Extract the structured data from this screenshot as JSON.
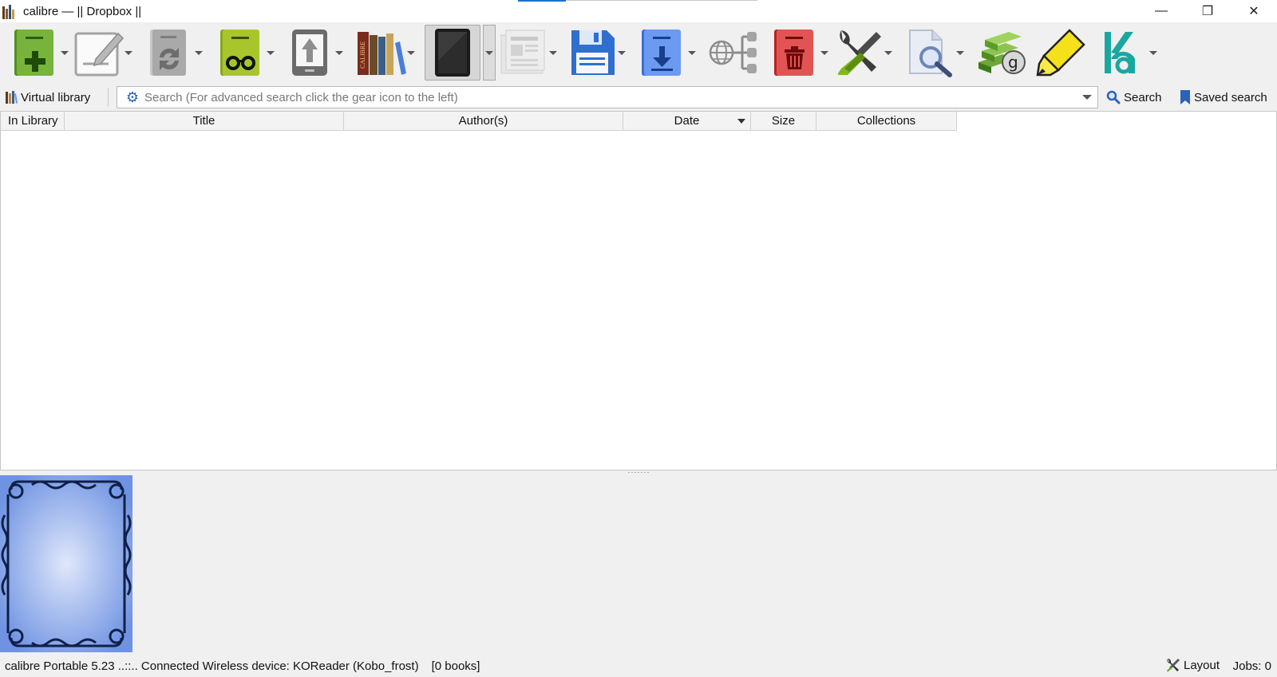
{
  "window": {
    "title": "calibre — || Dropbox ||",
    "controls": {
      "minimize": "—",
      "maximize": "❐",
      "close": "✕"
    }
  },
  "toolbar": {
    "items": [
      {
        "name": "add-books",
        "icon": "add-book-icon",
        "has_menu": true
      },
      {
        "name": "edit-metadata",
        "icon": "edit-metadata-icon",
        "has_menu": true
      },
      {
        "name": "convert-books",
        "icon": "convert-icon",
        "has_menu": true
      },
      {
        "name": "view",
        "icon": "view-book-icon",
        "has_menu": true
      },
      {
        "name": "send-to-device",
        "icon": "send-to-device-icon",
        "has_menu": true
      },
      {
        "name": "calibre-library",
        "icon": "library-icon",
        "has_menu": true
      },
      {
        "name": "device",
        "icon": "device-tablet-icon",
        "has_menu": true
      },
      {
        "name": "fetch-news",
        "icon": "news-icon",
        "has_menu": true
      },
      {
        "name": "save-to-disk",
        "icon": "save-icon",
        "has_menu": true
      },
      {
        "name": "get-books",
        "icon": "download-book-icon",
        "has_menu": true
      },
      {
        "name": "connect-share",
        "icon": "connect-share-icon",
        "has_menu": false
      },
      {
        "name": "remove-books",
        "icon": "trash-icon",
        "has_menu": true
      },
      {
        "name": "preferences",
        "icon": "tools-icon",
        "has_menu": true
      },
      {
        "name": "search-books",
        "icon": "document-search-icon",
        "has_menu": true
      },
      {
        "name": "goodreads",
        "icon": "goodreads-books-icon",
        "has_menu": false
      },
      {
        "name": "highlight",
        "icon": "highlighter-icon",
        "has_menu": false
      },
      {
        "name": "kobo-utilities",
        "icon": "kobo-icon",
        "has_menu": true
      }
    ]
  },
  "searchbar": {
    "virtual_library_label": "Virtual library",
    "placeholder": "Search (For advanced search click the gear icon to the left)",
    "value": "",
    "search_label": "Search",
    "saved_search_label": "Saved search"
  },
  "table": {
    "columns": [
      "In Library",
      "Title",
      "Author(s)",
      "Date",
      "Size",
      "Collections"
    ],
    "sorted_column": "Date",
    "rows": []
  },
  "status": {
    "message": "calibre Portable 5.23 ..::.. Connected Wireless device: KOReader (Kobo_frost)",
    "book_count": "[0 books]",
    "layout_label": "Layout",
    "jobs_label": "Jobs: 0"
  },
  "colors": {
    "accent": "#1a73c8",
    "cover_blue": "#7c9ee6",
    "add_green": "#6fa832",
    "remove_red": "#d83a3a",
    "kobo_teal": "#1aa7a0"
  }
}
